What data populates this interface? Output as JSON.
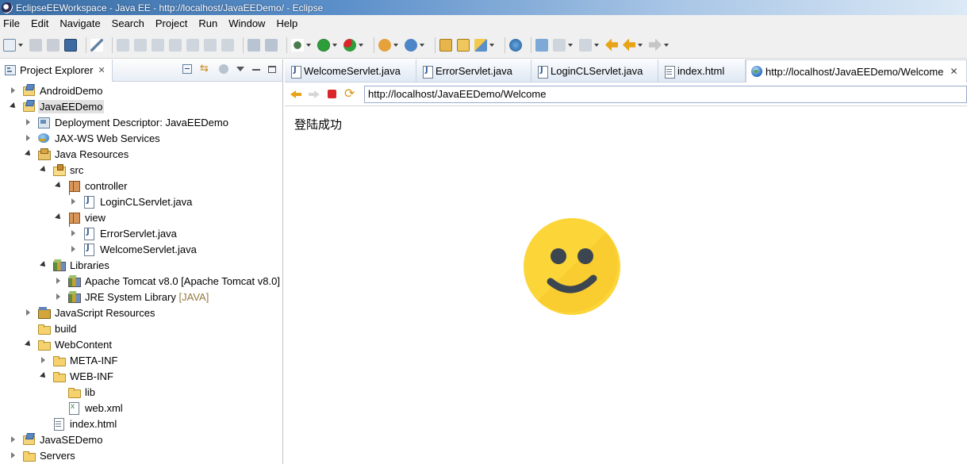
{
  "window": {
    "title": "EclipseEEWorkspace - Java EE - http://localhost/JavaEEDemo/ - Eclipse"
  },
  "menu": [
    "File",
    "Edit",
    "Navigate",
    "Search",
    "Project",
    "Run",
    "Window",
    "Help"
  ],
  "project_explorer": {
    "title": "Project Explorer",
    "close": "✕",
    "tree": [
      {
        "label": "AndroidDemo",
        "icon": "project-icon"
      },
      {
        "label": "JavaEEDemo",
        "icon": "project-icon"
      },
      {
        "label": "Deployment Descriptor: JavaEEDemo",
        "icon": "deployment-descriptor-icon"
      },
      {
        "label": "JAX-WS Web Services",
        "icon": "web-services-icon"
      },
      {
        "label": "Java Resources",
        "icon": "java-resources-icon"
      },
      {
        "label": "src",
        "icon": "source-folder-icon"
      },
      {
        "label": "controller",
        "icon": "package-icon"
      },
      {
        "label": "LoginCLServlet.java",
        "icon": "java-file-icon"
      },
      {
        "label": "view",
        "icon": "package-icon"
      },
      {
        "label": "ErrorServlet.java",
        "icon": "java-file-icon"
      },
      {
        "label": "WelcomeServlet.java",
        "icon": "java-file-icon"
      },
      {
        "label": "Libraries",
        "icon": "library-icon"
      },
      {
        "label": "Apache Tomcat v8.0 [Apache Tomcat v8.0]",
        "icon": "library-icon"
      },
      {
        "label": "JRE System Library",
        "decoration": "[JAVA]",
        "icon": "library-icon"
      },
      {
        "label": "JavaScript Resources",
        "icon": "javascript-resources-icon"
      },
      {
        "label": "build",
        "icon": "folder-icon"
      },
      {
        "label": "WebContent",
        "icon": "folder-icon"
      },
      {
        "label": "META-INF",
        "icon": "folder-icon"
      },
      {
        "label": "WEB-INF",
        "icon": "folder-icon"
      },
      {
        "label": "lib",
        "icon": "folder-icon"
      },
      {
        "label": "web.xml",
        "icon": "xml-file-icon"
      },
      {
        "label": "index.html",
        "icon": "html-file-icon"
      },
      {
        "label": "JavaSEDemo",
        "icon": "project-icon"
      },
      {
        "label": "Servers",
        "icon": "folder-icon"
      }
    ]
  },
  "editor": {
    "tabs": [
      {
        "label": "WelcomeServlet.java",
        "icon": "java-file-icon"
      },
      {
        "label": "ErrorServlet.java",
        "icon": "java-file-icon"
      },
      {
        "label": "LoginCLServlet.java",
        "icon": "java-file-icon"
      },
      {
        "label": "index.html",
        "icon": "html-file-icon"
      },
      {
        "label": "http://localhost/JavaEEDemo/Welcome",
        "icon": "globe-icon",
        "close": "✕"
      }
    ],
    "browser": {
      "url": "http://localhost/JavaEEDemo/Welcome",
      "message": "登陆成功"
    }
  },
  "colors": {
    "smiley_face": "#fcd538",
    "smiley_features": "#3b4650"
  }
}
